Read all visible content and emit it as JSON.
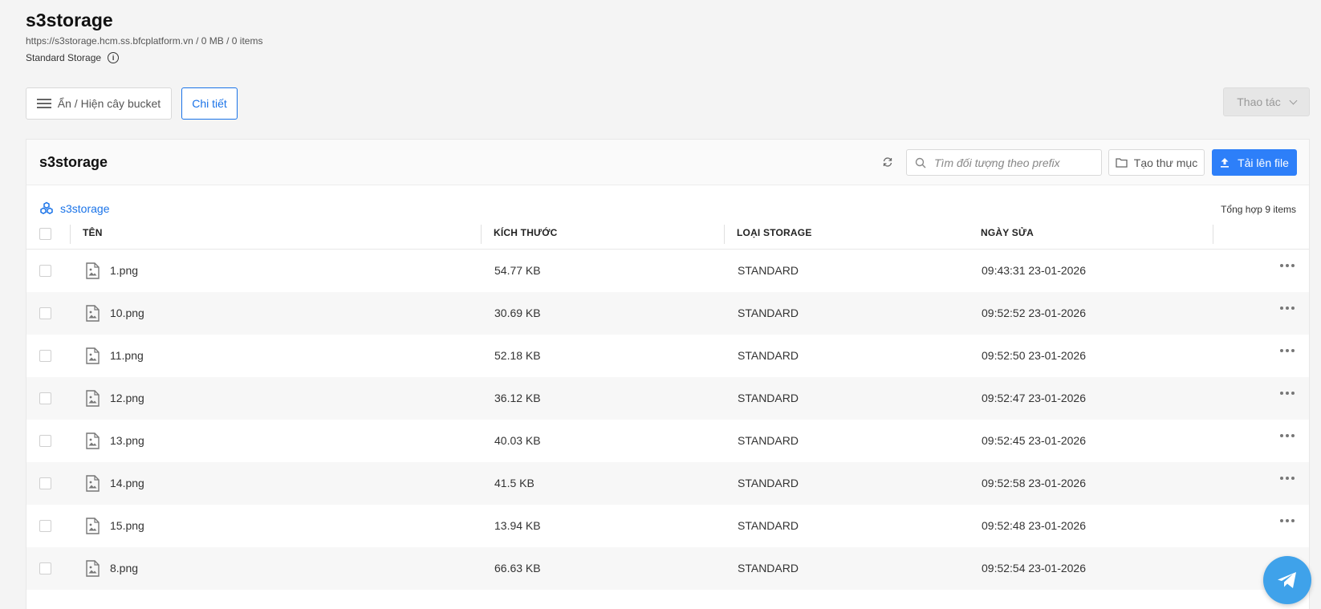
{
  "header": {
    "title": "s3storage",
    "endpoint_info": "https://s3storage.hcm.ss.bfcplatform.vn / 0 MB / 0 items",
    "storage_class": "Standard Storage"
  },
  "toolbar": {
    "toggle_tree_label": "Ẩn / Hiện cây bucket",
    "detail_label": "Chi tiết",
    "actions_label": "Thao tác"
  },
  "panel": {
    "title": "s3storage",
    "search_placeholder": "Tìm đối tượng theo prefix",
    "new_folder_label": "Tạo thư mục",
    "upload_label": "Tải lên file",
    "breadcrumb": "s3storage",
    "total": "Tổng hợp 9 items"
  },
  "table": {
    "columns": [
      "TÊN",
      "KÍCH THƯỚC",
      "LOẠI STORAGE",
      "NGÀY SỬA"
    ],
    "rows": [
      {
        "name": "1.png",
        "size": "54.77 KB",
        "type": "STANDARD",
        "date": "09:43:31 23-01-2026"
      },
      {
        "name": "10.png",
        "size": "30.69 KB",
        "type": "STANDARD",
        "date": "09:52:52 23-01-2026"
      },
      {
        "name": "11.png",
        "size": "52.18 KB",
        "type": "STANDARD",
        "date": "09:52:50 23-01-2026"
      },
      {
        "name": "12.png",
        "size": "36.12 KB",
        "type": "STANDARD",
        "date": "09:52:47 23-01-2026"
      },
      {
        "name": "13.png",
        "size": "40.03 KB",
        "type": "STANDARD",
        "date": "09:52:45 23-01-2026"
      },
      {
        "name": "14.png",
        "size": "41.5 KB",
        "type": "STANDARD",
        "date": "09:52:58 23-01-2026"
      },
      {
        "name": "15.png",
        "size": "13.94 KB",
        "type": "STANDARD",
        "date": "09:52:48 23-01-2026"
      },
      {
        "name": "8.png",
        "size": "66.63 KB",
        "type": "STANDARD",
        "date": "09:52:54 23-01-2026"
      }
    ]
  },
  "icons": {
    "file": "image-file-icon",
    "more": "more-icon",
    "fab": "telegram-icon"
  },
  "colors": {
    "accent": "#1a73e8",
    "upload": "#2d7ff9",
    "fab": "#3fa2ea"
  }
}
